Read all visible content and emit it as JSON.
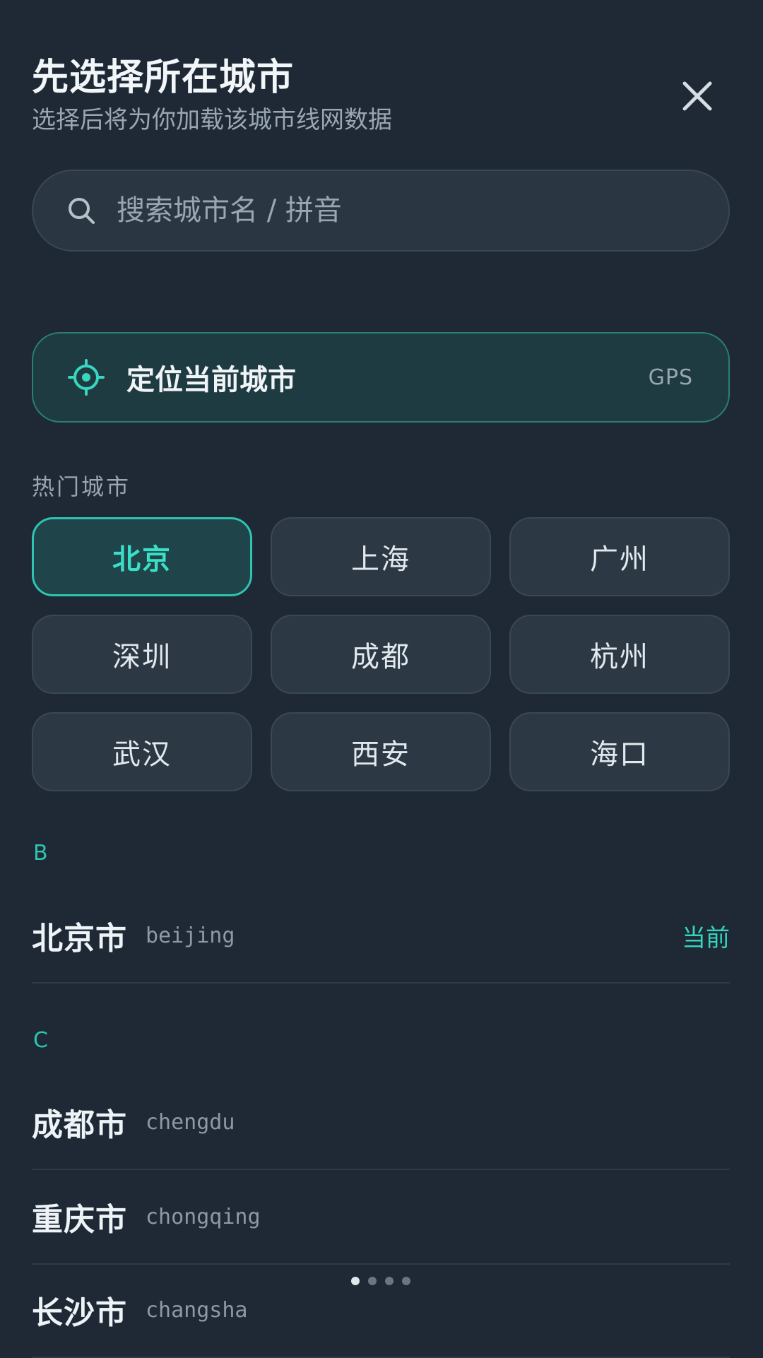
{
  "header": {
    "title": "先选择所在城市",
    "subtitle": "选择后将为你加载该城市线网数据",
    "close_icon": "close-icon"
  },
  "search": {
    "placeholder": "搜索城市名 / 拼音",
    "value": "",
    "icon": "search-icon"
  },
  "locate": {
    "label": "定位当前城市",
    "badge": "GPS",
    "icon": "crosshair-icon"
  },
  "hot": {
    "title": "热门城市",
    "selected": "北京",
    "cities": [
      "北京",
      "上海",
      "广州",
      "深圳",
      "成都",
      "杭州",
      "武汉",
      "西安",
      "海口"
    ]
  },
  "sections": [
    {
      "letter": "B",
      "items": [
        {
          "name": "北京市",
          "pinyin": "beijing",
          "tag": "当前"
        }
      ]
    },
    {
      "letter": "C",
      "items": [
        {
          "name": "成都市",
          "pinyin": "chengdu"
        },
        {
          "name": "重庆市",
          "pinyin": "chongqing"
        },
        {
          "name": "长沙市",
          "pinyin": "changsha"
        }
      ]
    }
  ],
  "pager": {
    "current": 1,
    "total": 4
  },
  "colors": {
    "background": "#1e2935",
    "accent": "#2fc3b0",
    "card": "#2c3844"
  }
}
